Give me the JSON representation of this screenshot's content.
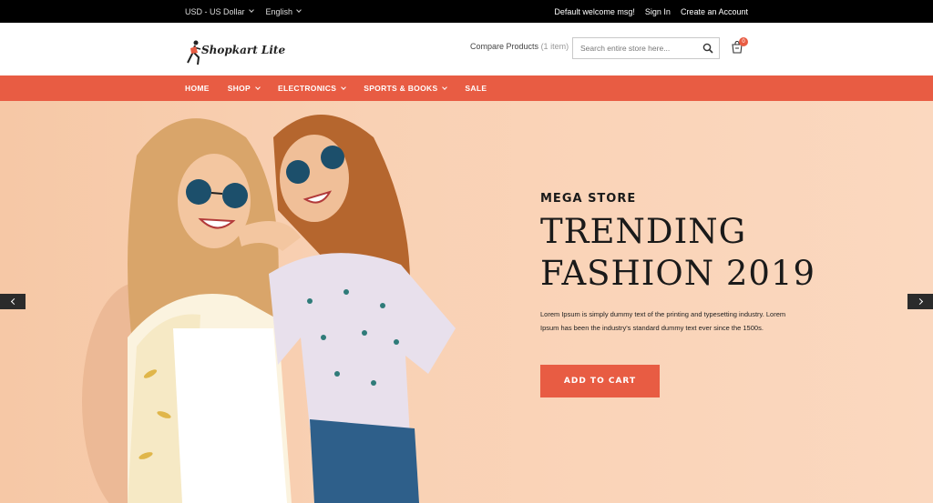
{
  "topbar": {
    "currency": "USD - US Dollar",
    "language": "English",
    "welcome": "Default welcome msg!",
    "sign_in": "Sign In",
    "create_account": "Create an Account"
  },
  "header": {
    "logo_text": "Shopkart Lite",
    "compare_label": "Compare Products",
    "compare_count": "(1 item)",
    "search_placeholder": "Search entire store here...",
    "cart_count": "0",
    "icons": [
      "search-icon",
      "cart-icon"
    ]
  },
  "nav": {
    "items": [
      {
        "label": "HOME",
        "dropdown": false
      },
      {
        "label": "SHOP",
        "dropdown": true
      },
      {
        "label": "ELECTRONICS",
        "dropdown": true
      },
      {
        "label": "SPORTS & BOOKS",
        "dropdown": true
      },
      {
        "label": "SALE",
        "dropdown": false
      }
    ]
  },
  "hero": {
    "kicker": "MEGA STORE",
    "headline_line1": "TRENDING",
    "headline_line2": "FASHION 2019",
    "description": "Lorem Ipsum is simply dummy text of the printing and typesetting industry. Lorem Ipsum has been the industry's standard dummy text ever since the 1500s.",
    "cta_label": "ADD TO CART"
  },
  "colors": {
    "accent": "#e85c43",
    "topbar_bg": "#000000",
    "hero_bg": "#f9d1b4"
  }
}
